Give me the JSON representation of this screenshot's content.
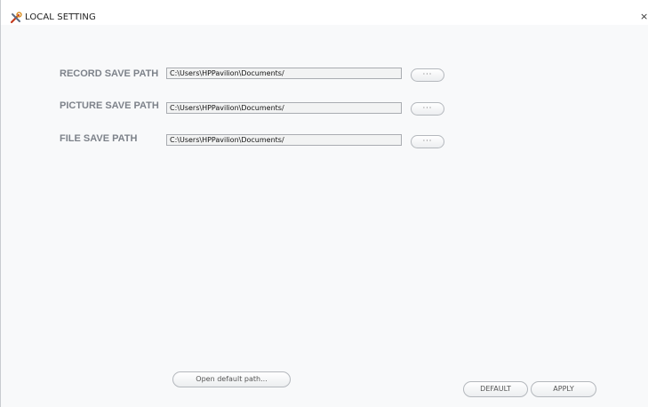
{
  "window": {
    "title": "LOCAL SETTING",
    "close_glyph": "×"
  },
  "paths": [
    {
      "label": "RECORD SAVE PATH",
      "value": "C:\\Users\\HPPavilion\\Documents/",
      "browse_label": "···"
    },
    {
      "label": "PICTURE SAVE PATH",
      "value": "C:\\Users\\HPPavilion\\Documents/",
      "browse_label": "···"
    },
    {
      "label": "FILE SAVE PATH",
      "value": "C:\\Users\\HPPavilion\\Documents/",
      "browse_label": "···"
    }
  ],
  "footer": {
    "open_default_label": "Open default path...",
    "default_label": "DEFAULT",
    "apply_label": "APPLY"
  },
  "icons": {
    "title_icon": "tools-icon"
  }
}
